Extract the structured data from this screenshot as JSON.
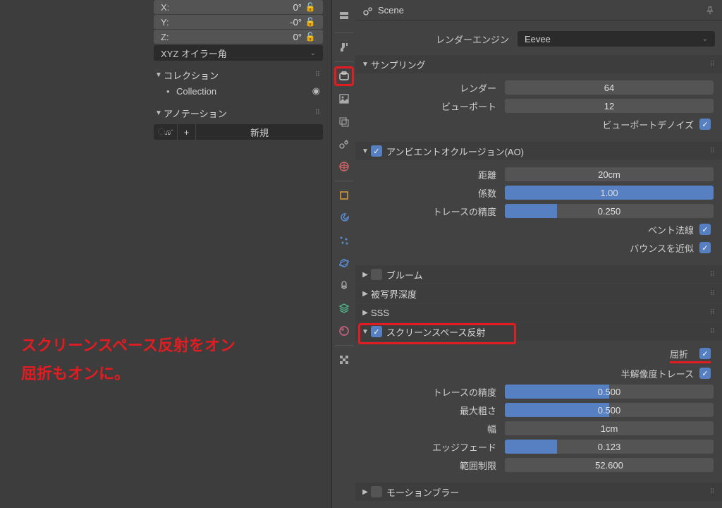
{
  "left": {
    "rot": {
      "x_label": "X:",
      "x_val": "0°",
      "y_label": "Y:",
      "y_val": "-0°",
      "z_label": "Z:",
      "z_val": "0°"
    },
    "euler_mode": "XYZ オイラー角",
    "section_collection": "コレクション",
    "collection_item": "Collection",
    "section_annotation": "アノテーション",
    "annotation_new": "新規"
  },
  "overlay": {
    "line1": "スクリーンスペース反射をオン",
    "line2": "屈折もオンに。"
  },
  "header": {
    "title": "Scene"
  },
  "render_engine": {
    "label": "レンダーエンジン",
    "value": "Eevee"
  },
  "sampling": {
    "title": "サンプリング",
    "render_label": "レンダー",
    "render_val": "64",
    "viewport_label": "ビューポート",
    "viewport_val": "12",
    "denoise_label": "ビューポートデノイズ"
  },
  "ao": {
    "title": "アンビエントオクルージョン(AO)",
    "distance_label": "距離",
    "distance_val": "20cm",
    "factor_label": "係数",
    "factor_val": "1.00",
    "trace_label": "トレースの精度",
    "trace_val": "0.250",
    "bent_label": "ベント法線",
    "bounce_label": "バウンスを近似"
  },
  "bloom": {
    "title": "ブルーム"
  },
  "dof": {
    "title": "被写界深度"
  },
  "sss": {
    "title": "SSS"
  },
  "ssr": {
    "title": "スクリーンスペース反射",
    "refract_label": "屈折",
    "halfres_label": "半解像度トレース",
    "trace_label": "トレースの精度",
    "trace_val": "0.500",
    "rough_label": "最大粗さ",
    "rough_val": "0.500",
    "width_label": "幅",
    "width_val": "1cm",
    "edge_label": "エッジフェード",
    "edge_val": "0.123",
    "clamp_label": "範囲制限",
    "clamp_val": "52.600"
  },
  "motion_blur": {
    "title": "モーションブラー"
  }
}
